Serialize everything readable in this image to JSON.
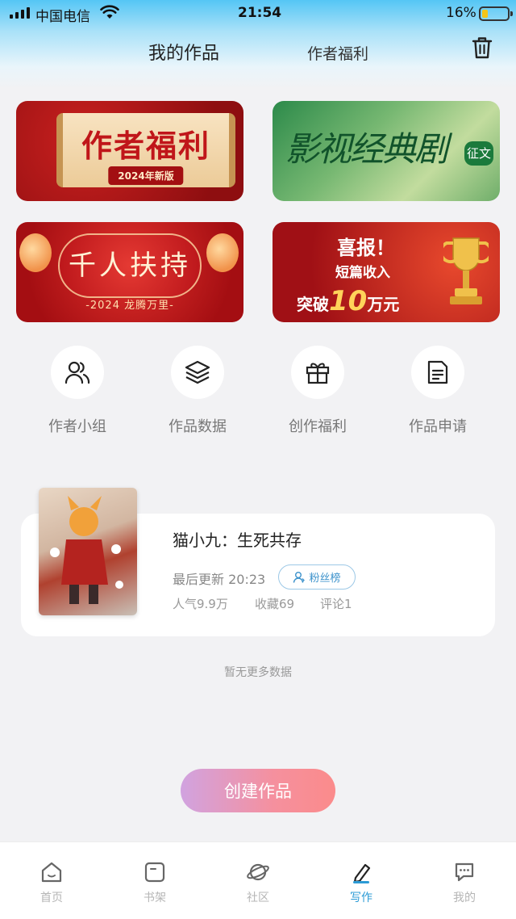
{
  "status_bar": {
    "carrier": "中国电信",
    "time": "21:54",
    "battery": "16%"
  },
  "header": {
    "title": "我的作品",
    "welfare": "作者福利",
    "trash_icon": "trash-icon"
  },
  "banners": [
    {
      "title": "作者福利",
      "subtitle": "2024年新版"
    },
    {
      "title": "影视经典剧",
      "tag": "征文"
    },
    {
      "title": "千人扶持",
      "subtitle": "-2024 龙腾万里-"
    },
    {
      "line1": "喜报！",
      "line2": "短篇收入",
      "line3_pre": "突破",
      "line3_num": "10",
      "line3_post": "万元"
    }
  ],
  "shortcuts": [
    {
      "label": "作者小组",
      "icon": "users-icon"
    },
    {
      "label": "作品数据",
      "icon": "layers-icon"
    },
    {
      "label": "创作福利",
      "icon": "gift-icon"
    },
    {
      "label": "作品申请",
      "icon": "document-icon"
    }
  ],
  "work": {
    "title": "猫小九：生死共存",
    "updated": "最后更新 20:23",
    "fans_label": "粉丝榜",
    "popularity": "人气9.9万",
    "favorites": "收藏69",
    "comments": "评论1"
  },
  "no_more": "暂无更多数据",
  "create_button": "创建作品",
  "tabs": [
    {
      "label": "首页",
      "icon": "home-icon",
      "active": false
    },
    {
      "label": "书架",
      "icon": "bookshelf-icon",
      "active": false
    },
    {
      "label": "社区",
      "icon": "planet-icon",
      "active": false
    },
    {
      "label": "写作",
      "icon": "pen-icon",
      "active": true
    },
    {
      "label": "我的",
      "icon": "chat-icon",
      "active": false
    }
  ],
  "colors": {
    "accent": "#2c9bd6",
    "create_gradient_start": "#d1a3e0",
    "create_gradient_end": "#fb8b8b"
  }
}
